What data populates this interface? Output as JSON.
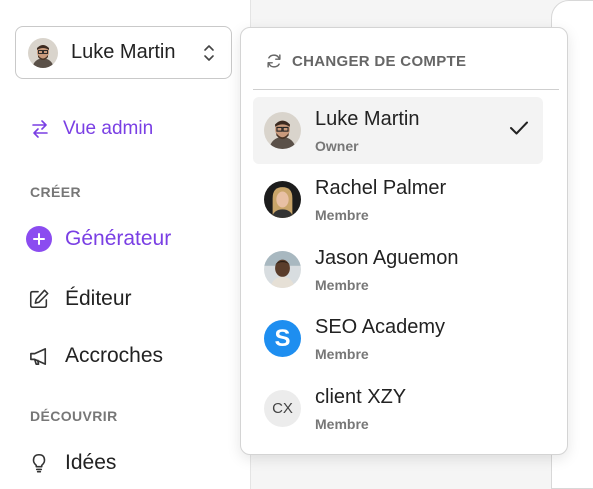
{
  "account_switcher": {
    "current_name": "Luke Martin"
  },
  "sidebar": {
    "admin_link": "Vue admin",
    "section_create": "CRÉER",
    "section_discover": "DÉCOUVRIR",
    "items": [
      {
        "label": "Générateur",
        "icon": "plus-circle-icon",
        "active": true
      },
      {
        "label": "Éditeur",
        "icon": "edit-icon",
        "active": false
      },
      {
        "label": "Accroches",
        "icon": "megaphone-icon",
        "active": false
      },
      {
        "label": "Idées",
        "icon": "lightbulb-icon",
        "active": false
      }
    ]
  },
  "dropdown": {
    "header": "CHANGER DE COMPTE",
    "accounts": [
      {
        "name": "Luke Martin",
        "role": "Owner",
        "avatar": "photo",
        "selected": true
      },
      {
        "name": "Rachel Palmer",
        "role": "Membre",
        "avatar": "photo",
        "selected": false
      },
      {
        "name": "Jason Aguemon",
        "role": "Membre",
        "avatar": "photo",
        "selected": false
      },
      {
        "name": "SEO Academy",
        "role": "Membre",
        "avatar": "S",
        "selected": false
      },
      {
        "name": "client XZY",
        "role": "Membre",
        "avatar": "CX",
        "selected": false
      }
    ]
  },
  "colors": {
    "accent": "#7a3fe4",
    "accent_fill": "#8b4cf0",
    "seo_blue": "#1e8ef0"
  }
}
